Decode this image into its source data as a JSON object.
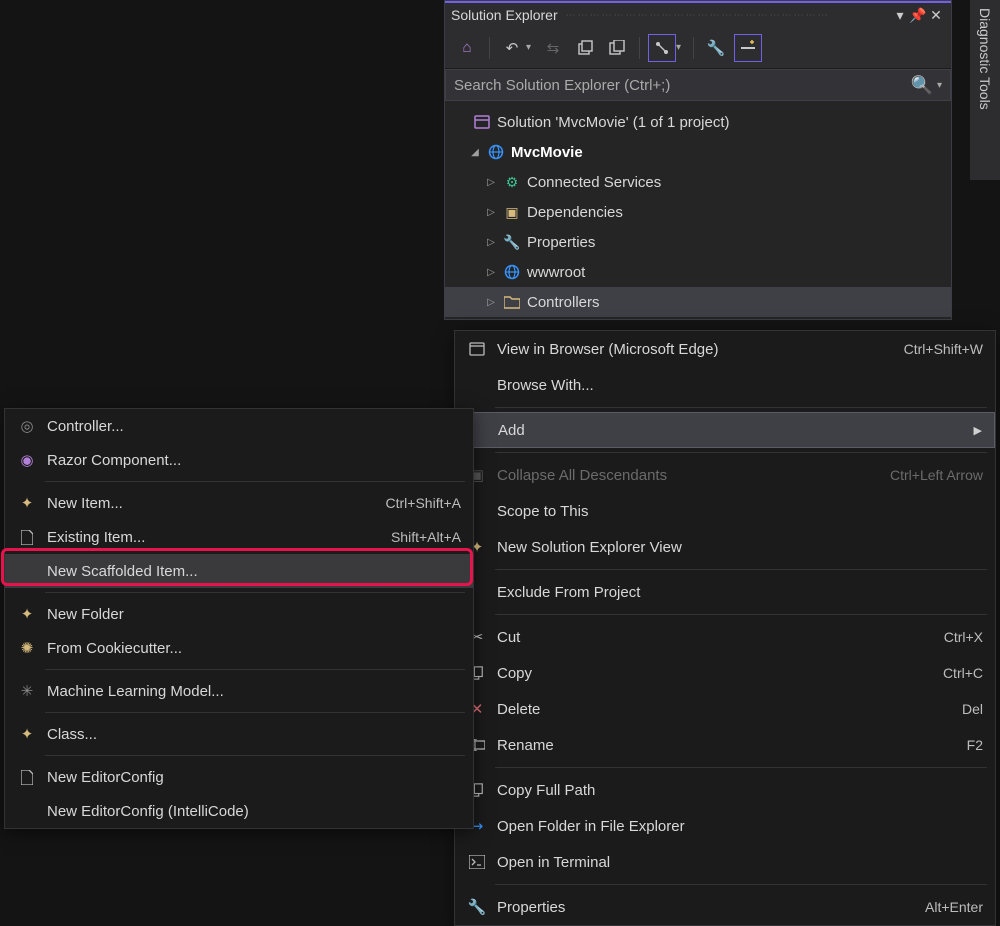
{
  "sidetab": {
    "label": "Diagnostic Tools"
  },
  "panel": {
    "title": "Solution Explorer",
    "search_placeholder": "Search Solution Explorer (Ctrl+;)"
  },
  "tree": {
    "solution": "Solution 'MvcMovie' (1 of 1 project)",
    "project": "MvcMovie",
    "items": [
      "Connected Services",
      "Dependencies",
      "Properties",
      "wwwroot",
      "Controllers"
    ]
  },
  "ctx_right": {
    "view_browser": {
      "label": "View in Browser (Microsoft Edge)",
      "shortcut": "Ctrl+Shift+W"
    },
    "browse_with": {
      "label": "Browse With..."
    },
    "add": {
      "label": "Add"
    },
    "collapse": {
      "label": "Collapse All Descendants",
      "shortcut": "Ctrl+Left Arrow"
    },
    "scope": {
      "label": "Scope to This"
    },
    "new_view": {
      "label": "New Solution Explorer View"
    },
    "exclude": {
      "label": "Exclude From Project"
    },
    "cut": {
      "label": "Cut",
      "shortcut": "Ctrl+X"
    },
    "copy": {
      "label": "Copy",
      "shortcut": "Ctrl+C"
    },
    "delete": {
      "label": "Delete",
      "shortcut": "Del"
    },
    "rename": {
      "label": "Rename",
      "shortcut": "F2"
    },
    "copy_path": {
      "label": "Copy Full Path"
    },
    "open_folder": {
      "label": "Open Folder in File Explorer"
    },
    "open_terminal": {
      "label": "Open in Terminal"
    },
    "properties": {
      "label": "Properties",
      "shortcut": "Alt+Enter"
    }
  },
  "ctx_left": {
    "controller": "Controller...",
    "razor": "Razor Component...",
    "new_item": {
      "label": "New Item...",
      "shortcut": "Ctrl+Shift+A"
    },
    "existing_item": {
      "label": "Existing Item...",
      "shortcut": "Shift+Alt+A"
    },
    "scaffolded": "New Scaffolded Item...",
    "new_folder": "New Folder",
    "cookiecutter": "From Cookiecutter...",
    "ml_model": "Machine Learning Model...",
    "class": "Class...",
    "editorconfig": "New EditorConfig",
    "editorconfig_ic": "New EditorConfig (IntelliCode)"
  }
}
